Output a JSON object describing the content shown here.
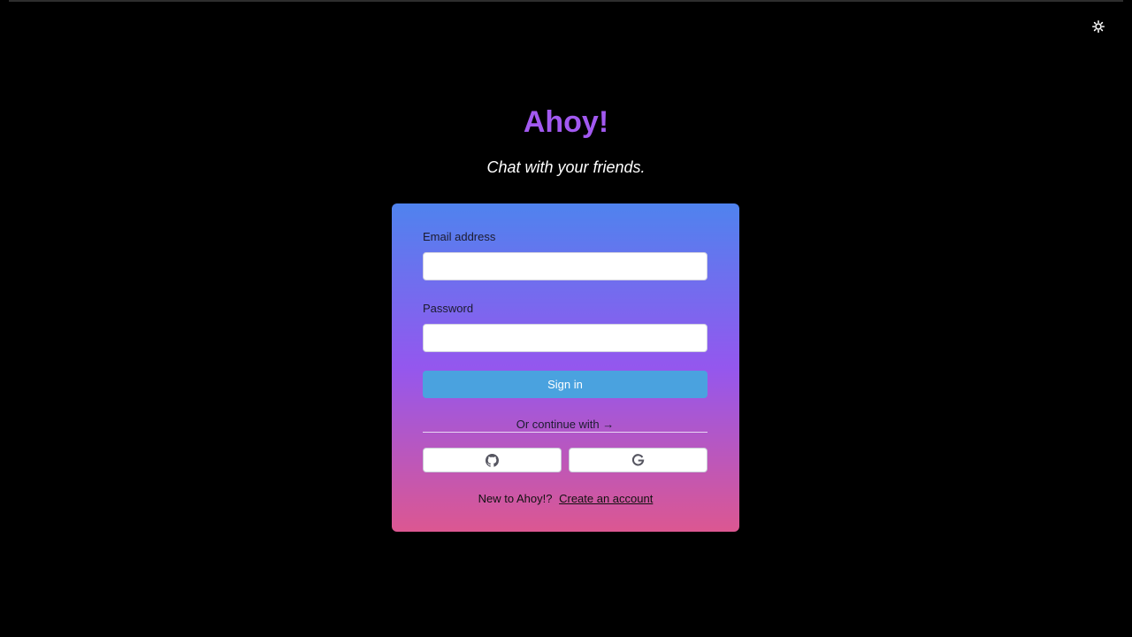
{
  "header": {
    "theme_toggle_icon": "sun-icon"
  },
  "brand": {
    "title": "Ahoy!",
    "tagline": "Chat with your friends.",
    "title_color": "#a259f0"
  },
  "login_form": {
    "email_label": "Email address",
    "email_value": "",
    "password_label": "Password",
    "password_value": "",
    "signin_label": "Sign in",
    "divider_text": "Or continue with →",
    "social_providers": [
      {
        "name": "GitHub",
        "icon": "github-icon"
      },
      {
        "name": "Google",
        "icon": "google-icon"
      }
    ],
    "signup_prompt": "New to Ahoy!?",
    "signup_link": "Create an account",
    "gradient_colors": [
      "#4f83ee",
      "#9457ee",
      "#dc5791"
    ],
    "button_color": "#4aa2df"
  }
}
